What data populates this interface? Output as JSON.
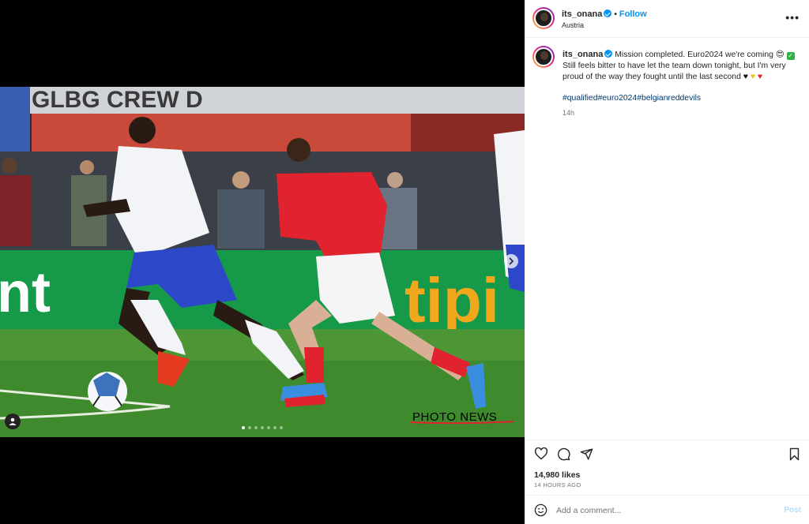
{
  "post": {
    "username": "its_onana",
    "follow_label": "Follow",
    "separator": "•",
    "location": "Austria",
    "more_label": "•••",
    "caption_line1": "Mission completed. Euro2024 we're coming",
    "caption_line2": "Still feels bitter to have let the team down tonight, but I'm very proud of the way they fought until the last second",
    "hashtags": [
      "#qualified",
      "#euro2024",
      "#belgianreddevils"
    ],
    "caption_time": "14h",
    "likes": "14,980 likes",
    "time_ago": "14 HOURS AGO"
  },
  "media": {
    "watermark": "PHOTO NEWS",
    "carousel_count": 7,
    "carousel_active": 0,
    "billboard_text": "tipi",
    "banner_text": "GLBG CREW D"
  },
  "comment": {
    "placeholder": "Add a comment...",
    "post_label": "Post"
  },
  "colors": {
    "accent": "#0095f6",
    "hashtag": "#00376b",
    "grass": "#3f8a2c",
    "austria_red": "#e1222f",
    "belgium_white": "#f2f4f8"
  },
  "icons": {
    "like": "heart-icon",
    "comment": "comment-icon",
    "share": "share-icon",
    "save": "bookmark-icon",
    "emoji": "emoji-icon",
    "tag": "user-tag-icon",
    "next": "chevron-right-icon"
  }
}
